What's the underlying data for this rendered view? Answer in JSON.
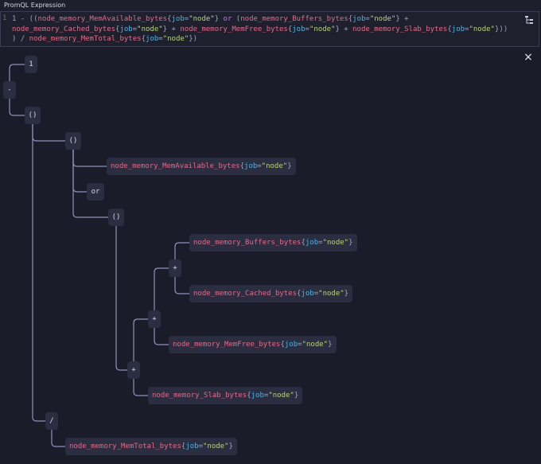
{
  "header": {
    "title": "PromQL Expression"
  },
  "editor": {
    "line_number": "1",
    "lines": [
      [
        [
          "1 - ((",
          "punct"
        ],
        [
          "node_memory_MemAvailable_bytes",
          "metric"
        ],
        [
          "{",
          "punct"
        ],
        [
          "job",
          "label"
        ],
        [
          "=",
          "punct"
        ],
        [
          "\"node\"",
          "string"
        ],
        [
          "} ",
          "punct"
        ],
        [
          "or",
          "op"
        ],
        [
          " (",
          "punct"
        ],
        [
          "node_memory_Buffers_bytes",
          "metric"
        ],
        [
          "{",
          "punct"
        ],
        [
          "job",
          "label"
        ],
        [
          "=",
          "punct"
        ],
        [
          "\"node\"",
          "string"
        ],
        [
          "} + ",
          "punct"
        ]
      ],
      [
        [
          "node_memory_Cached_bytes",
          "metric"
        ],
        [
          "{",
          "punct"
        ],
        [
          "job",
          "label"
        ],
        [
          "=",
          "punct"
        ],
        [
          "\"node\"",
          "string"
        ],
        [
          "} + ",
          "punct"
        ],
        [
          "node_memory_MemFree_bytes",
          "metric"
        ],
        [
          "{",
          "punct"
        ],
        [
          "job",
          "label"
        ],
        [
          "=",
          "punct"
        ],
        [
          "\"node\"",
          "string"
        ],
        [
          "} + ",
          "punct"
        ],
        [
          "node_memory_Slab_bytes",
          "metric"
        ],
        [
          "{",
          "punct"
        ],
        [
          "job",
          "label"
        ],
        [
          "=",
          "punct"
        ],
        [
          "\"node\"",
          "string"
        ],
        [
          "}))",
          "punct"
        ]
      ],
      [
        [
          ") / ",
          "punct"
        ],
        [
          "node_memory_MemTotal_bytes",
          "metric"
        ],
        [
          "{",
          "punct"
        ],
        [
          "job",
          "label"
        ],
        [
          "=",
          "punct"
        ],
        [
          "\"node\"",
          "string"
        ],
        [
          "})",
          "punct"
        ]
      ]
    ]
  },
  "icons": {
    "tree_toggle": "tree-view-icon",
    "close": "close-icon"
  },
  "close_label": "×",
  "colors": {
    "metric": "#e06c8a",
    "label": "#4fb3e6",
    "string": "#b4d67a",
    "operator": "#c678dd",
    "node_bg": "#2b2d40",
    "connector": "#8d93b8"
  },
  "tree": {
    "nodes": [
      {
        "id": "n1",
        "text": "1"
      },
      {
        "id": "minus",
        "text": "-"
      },
      {
        "id": "paren1",
        "text": "()"
      },
      {
        "id": "paren2",
        "text": "()"
      },
      {
        "id": "memavail",
        "metric": "node_memory_MemAvailable_bytes",
        "label": "job",
        "value": "\"node\""
      },
      {
        "id": "or",
        "text": "or"
      },
      {
        "id": "paren3",
        "text": "()"
      },
      {
        "id": "buffers",
        "metric": "node_memory_Buffers_bytes",
        "label": "job",
        "value": "\"node\""
      },
      {
        "id": "plus1",
        "text": "+"
      },
      {
        "id": "cached",
        "metric": "node_memory_Cached_bytes",
        "label": "job",
        "value": "\"node\""
      },
      {
        "id": "plus2",
        "text": "+"
      },
      {
        "id": "memfree",
        "metric": "node_memory_MemFree_bytes",
        "label": "job",
        "value": "\"node\""
      },
      {
        "id": "plus3",
        "text": "+"
      },
      {
        "id": "slab",
        "metric": "node_memory_Slab_bytes",
        "label": "job",
        "value": "\"node\""
      },
      {
        "id": "divide",
        "text": "/"
      },
      {
        "id": "memtotal",
        "metric": "node_memory_MemTotal_bytes",
        "label": "job",
        "value": "\"node\""
      }
    ]
  }
}
